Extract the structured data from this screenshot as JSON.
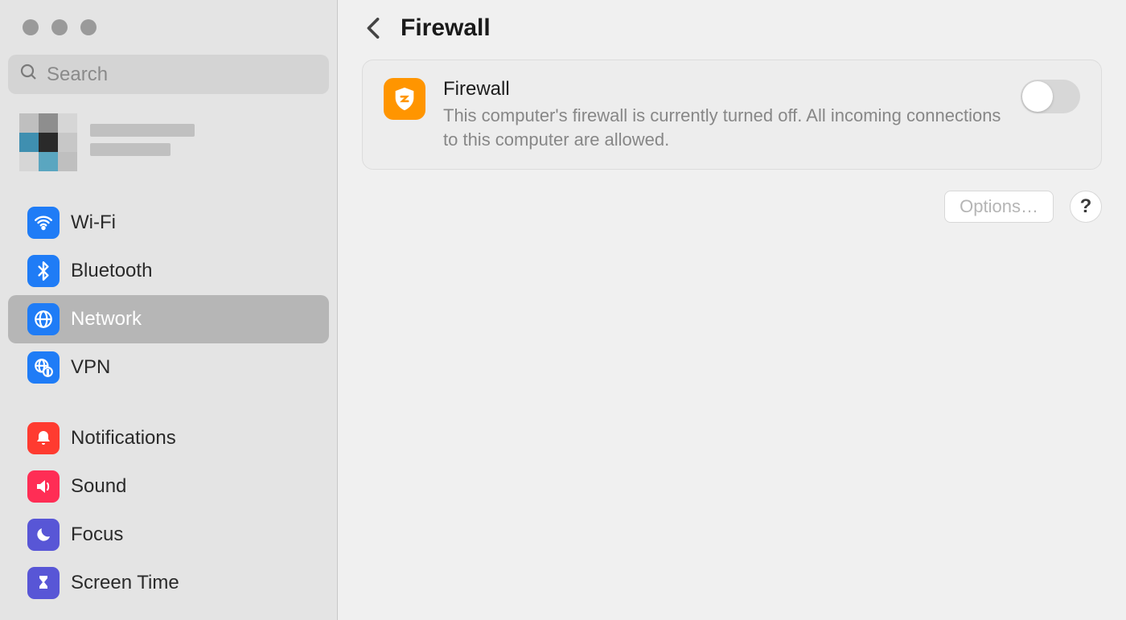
{
  "search": {
    "placeholder": "Search"
  },
  "sidebar": {
    "items": [
      {
        "label": "Wi-Fi"
      },
      {
        "label": "Bluetooth"
      },
      {
        "label": "Network"
      },
      {
        "label": "VPN"
      },
      {
        "label": "Notifications"
      },
      {
        "label": "Sound"
      },
      {
        "label": "Focus"
      },
      {
        "label": "Screen Time"
      }
    ]
  },
  "header": {
    "title": "Firewall"
  },
  "card": {
    "title": "Firewall",
    "description": "This computer's firewall is currently turned off. All incoming connections to this computer are allowed.",
    "toggle_on": false
  },
  "actions": {
    "options_label": "Options…",
    "help_label": "?"
  }
}
